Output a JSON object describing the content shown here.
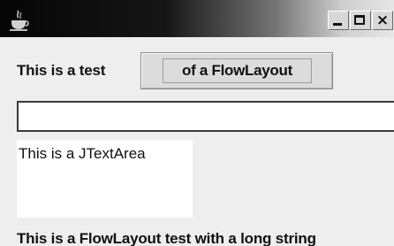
{
  "window": {
    "icon": "java-duke-icon",
    "controls": {
      "minimize": "_",
      "maximize": "□",
      "close": "×"
    }
  },
  "row1": {
    "label": "This is a test",
    "button": "of a FlowLayout"
  },
  "text_field": {
    "value": ""
  },
  "text_area": {
    "value": "This is a JTextArea"
  },
  "bottom_label": "This is a FlowLayout test with a long string"
}
